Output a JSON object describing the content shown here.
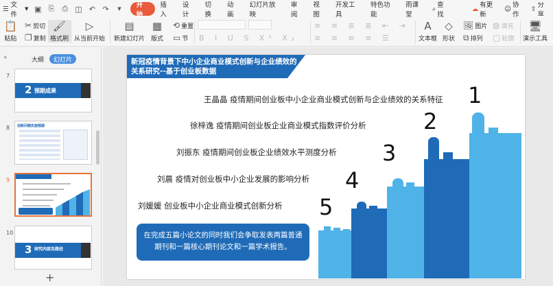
{
  "menubar": {
    "file_label": "文件",
    "tabs": [
      "开始",
      "插入",
      "设计",
      "切换",
      "动画",
      "幻灯片放映",
      "审阅",
      "视图",
      "开发工具",
      "特色功能",
      "雨课堂"
    ],
    "search_label": "查找",
    "update_label": "有更新",
    "collab_label": "协作",
    "share_label": "分享"
  },
  "ribbon": {
    "paste": "粘贴",
    "cut": "剪切",
    "copy": "复制",
    "format_painter": "格式刷",
    "from_current": "从当前开始",
    "new_slide": "新建幻灯片",
    "layout": "版式",
    "reset": "重置",
    "section": "节",
    "textbox": "文本框",
    "shape": "形状",
    "image": "图片",
    "arrange": "排列",
    "fill": "填充",
    "outline": "轮廓",
    "demo_tools": "演示工具"
  },
  "panel": {
    "tab_outline": "大纲",
    "tab_slides": "幻灯片",
    "slides": [
      {
        "num": "7",
        "title": "预期成果",
        "index": "2"
      },
      {
        "num": "8",
        "title": "创新问题实施预期"
      },
      {
        "num": "9"
      },
      {
        "num": "10",
        "title": "研究内容及路径",
        "index": "3"
      }
    ],
    "add_label": "+"
  },
  "slide": {
    "title": "新冠疫情背景下中小企业商业模式创新与企业绩效的关系研究--基于创业板数据",
    "papers": [
      "王晶晶 疫情期间创业板中小企业商业模式创新与企业绩效的关系特征",
      "徐梓逸 疫情期间创业板企业商业模式指数评价分析",
      "刘振东 疫情期间创业板企业绩效水平测度分析",
      "刘晨 疫情对创业板中小企业发展的影响分析",
      "刘媛媛 创业板中小企业商业模式创新分析"
    ],
    "numbers": [
      "1",
      "2",
      "3",
      "4",
      "5"
    ],
    "summary": "在完成五篇小论文的同时我们会争取发表两篇普通期刊和一篇核心期刊论文和一篇学术报告。"
  },
  "colors": {
    "accent": "#e85a3a",
    "slide_blue": "#1f6bb8",
    "hand_light": "#4fb3e8",
    "hand_dark": "#1f6bb8"
  }
}
